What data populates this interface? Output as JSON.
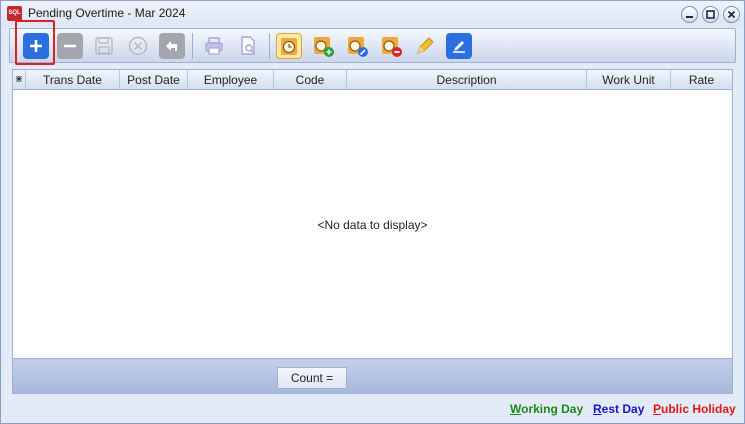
{
  "window": {
    "title": "Pending Overtime - Mar 2024",
    "icon": "app-logo-icon",
    "controls": [
      "minimize-icon",
      "maximize-icon",
      "close-icon"
    ]
  },
  "toolbar": {
    "buttons": [
      {
        "name": "add",
        "icon": "plus-icon",
        "state": "enabled"
      },
      {
        "name": "delete",
        "icon": "minus-icon",
        "state": "disabled"
      },
      {
        "name": "save",
        "icon": "floppy-icon",
        "state": "disabled"
      },
      {
        "name": "cancel",
        "icon": "x-circle-icon",
        "state": "disabled"
      },
      {
        "name": "undo",
        "icon": "back-arrow-icon",
        "state": "disabled"
      },
      {
        "name": "print",
        "icon": "printer-icon",
        "state": "disabled"
      },
      {
        "name": "preview",
        "icon": "page-magnifier-icon",
        "state": "disabled"
      },
      {
        "name": "overtime",
        "icon": "clock-folder-icon",
        "state": "active"
      },
      {
        "name": "add-overtime",
        "icon": "clock-add-icon",
        "state": "enabled"
      },
      {
        "name": "edit-overtime",
        "icon": "clock-edit-icon",
        "state": "enabled"
      },
      {
        "name": "remove-overtime",
        "icon": "clock-remove-icon",
        "state": "enabled"
      },
      {
        "name": "pencil",
        "icon": "pencil-icon",
        "state": "enabled"
      },
      {
        "name": "post",
        "icon": "post-sign-icon",
        "state": "enabled"
      }
    ]
  },
  "grid": {
    "columns": [
      "Trans Date",
      "Post Date",
      "Employee",
      "Code",
      "Description",
      "Work Unit",
      "Rate"
    ],
    "empty_message": "<No data to display>",
    "footer_count": "Count ="
  },
  "legend": {
    "working_day": {
      "first": "W",
      "rest": "orking Day",
      "color": "#1a8a1a"
    },
    "rest_day": {
      "first": "R",
      "rest": "est Day",
      "color": "#1515c8"
    },
    "public_holiday": {
      "first": "P",
      "rest": "ublic Holiday",
      "color": "#e01818"
    }
  },
  "colors": {
    "accent": "#2a6ee0",
    "highlight_box": "#e02020"
  }
}
